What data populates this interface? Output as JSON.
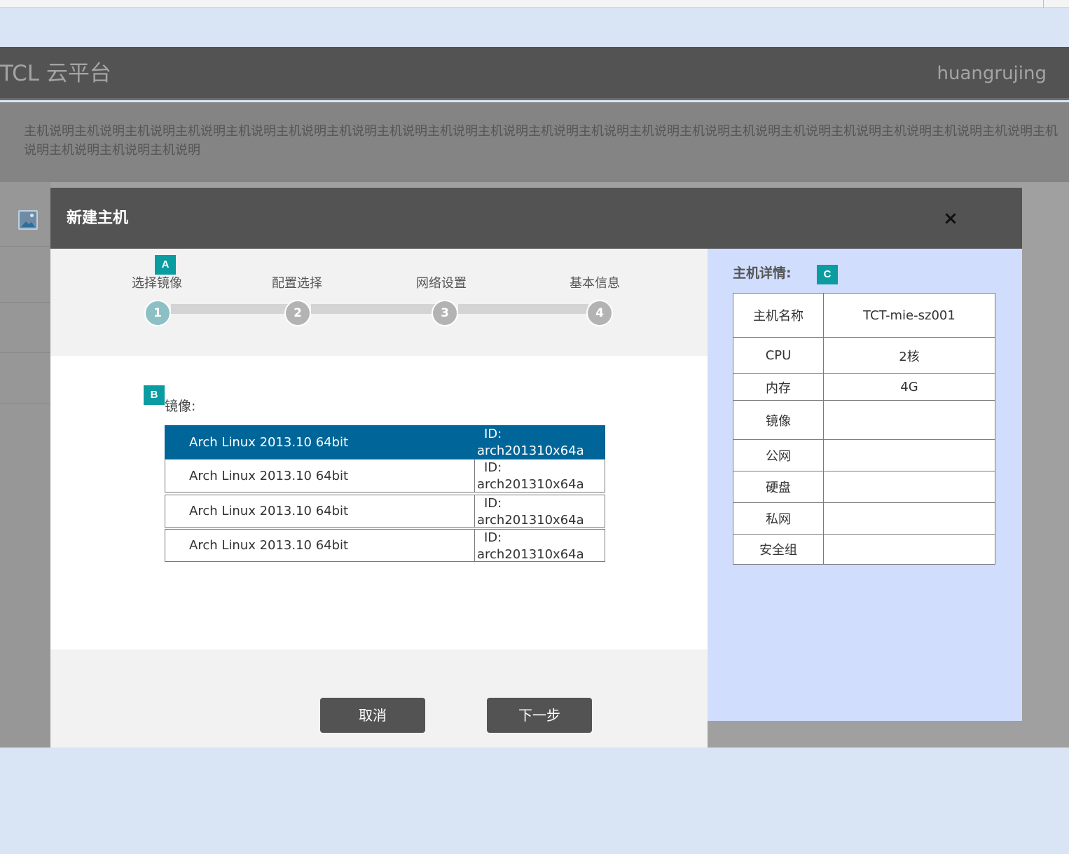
{
  "app": {
    "brand": "TCL 云平台",
    "username": "huangrujing"
  },
  "description": "主机说明主机说明主机说明主机说明主机说明主机说明主机说明主机说明主机说明主机说明主机说明主机说明主机说明主机说明主机说明主机说明主机说明主机说明主机说明主机说明主机说明主机说明主机说明主机说明",
  "modal": {
    "title": "新建主机",
    "close_icon": "×",
    "steps": [
      {
        "label": "选择镜像",
        "number": "1",
        "active": true
      },
      {
        "label": "配置选择",
        "number": "2",
        "active": false
      },
      {
        "label": "网络设置",
        "number": "3",
        "active": false
      },
      {
        "label": "基本信息",
        "number": "4",
        "active": false
      }
    ],
    "badges": {
      "a": "A",
      "b": "B",
      "c": "C"
    },
    "image_label": "镜像:",
    "images": [
      {
        "name": "Arch Linux 2013.10 64bit",
        "id_label": "ID:",
        "id_value": "arch201310x64a",
        "selected": true
      },
      {
        "name": "Arch Linux 2013.10 64bit",
        "id_label": "ID:",
        "id_value": "arch201310x64a",
        "selected": false
      },
      {
        "name": "Arch Linux 2013.10 64bit",
        "id_label": "ID:",
        "id_value": "arch201310x64a",
        "selected": false
      },
      {
        "name": "Arch Linux 2013.10 64bit",
        "id_label": "ID:",
        "id_value": "arch201310x64a",
        "selected": false
      }
    ],
    "cancel_label": "取消",
    "next_label": "下一步",
    "details": {
      "title": "主机详情:",
      "rows": [
        {
          "key": "主机名称",
          "value": "TCT-mie-sz001"
        },
        {
          "key": "CPU",
          "value": "2核"
        },
        {
          "key": "内存",
          "value": "4G"
        },
        {
          "key": "镜像",
          "value": ""
        },
        {
          "key": "公网",
          "value": ""
        },
        {
          "key": "硬盘",
          "value": ""
        },
        {
          "key": "私网",
          "value": ""
        },
        {
          "key": "安全组",
          "value": ""
        }
      ]
    }
  },
  "colors": {
    "page_background": "#d9e4f5",
    "header": "#535353",
    "selected_row": "#006699",
    "badge": "#0a9ca0",
    "details_panel": "#d0ddfd",
    "active_step": "#8cc0c4"
  },
  "icons": {
    "rail": "image-icon",
    "close": "close-icon"
  }
}
